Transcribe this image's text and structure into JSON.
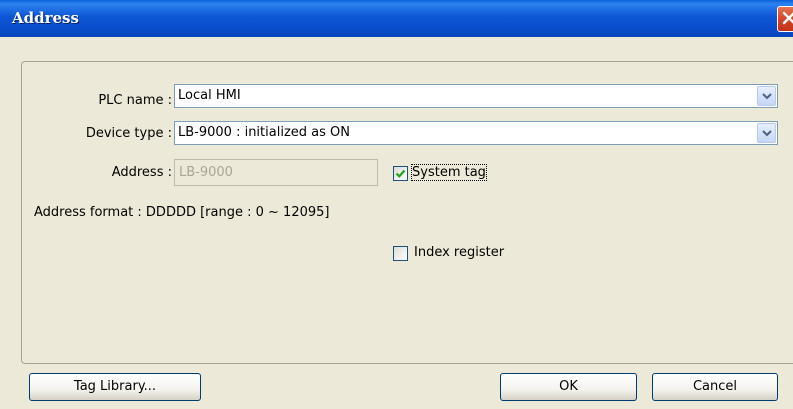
{
  "window": {
    "title": "Address",
    "close_icon": "close-icon"
  },
  "form": {
    "plc_name_label": "PLC name :",
    "plc_name_value": "Local HMI",
    "device_type_label": "Device type :",
    "device_type_value": "LB-9000 : initialized as ON",
    "address_label": "Address :",
    "address_value": "LB-9000",
    "system_tag_label": "System tag",
    "system_tag_checked": true,
    "address_format_text": "Address format : DDDDD [range : 0 ~ 12095]",
    "index_register_label": "Index register",
    "index_register_checked": false
  },
  "buttons": {
    "tag_library": "Tag Library...",
    "ok": "OK",
    "cancel": "Cancel"
  },
  "colors": {
    "titlebar": "#0a4cc9",
    "dialog_bg": "#ece9d8",
    "close": "#d6452a"
  }
}
